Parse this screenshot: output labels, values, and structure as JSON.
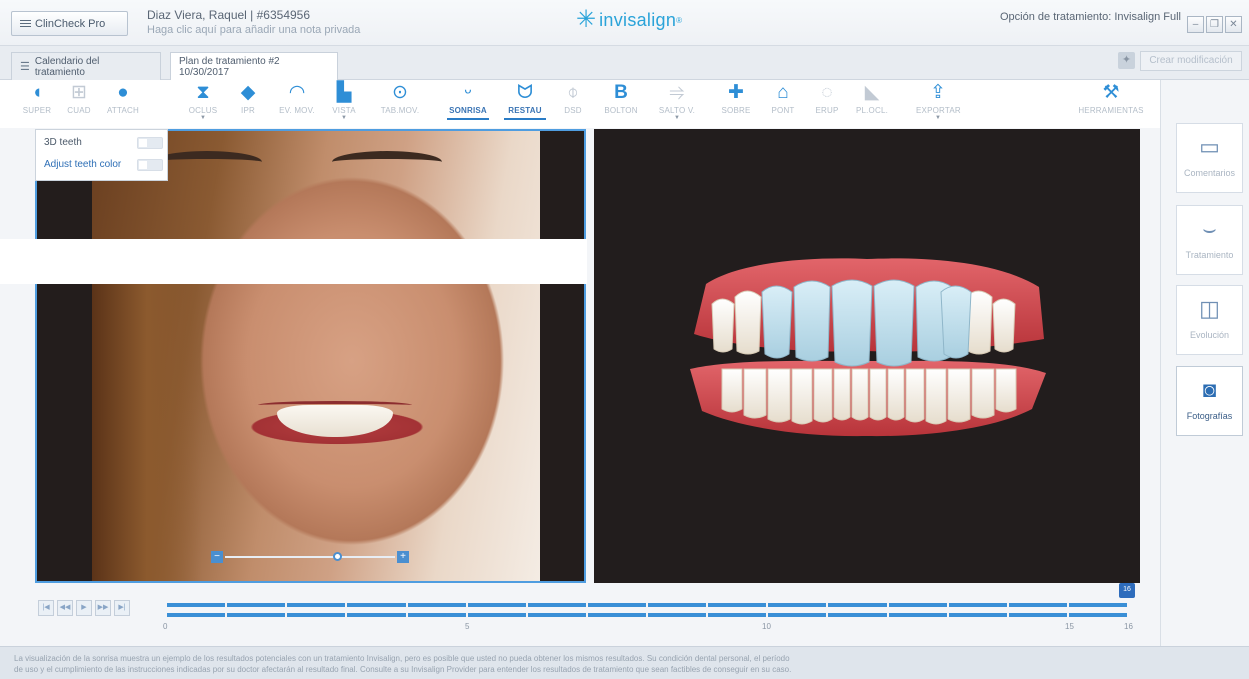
{
  "header": {
    "app_button": "ClinCheck Pro",
    "patient_name": "Diaz Viera, Raquel | #6354956",
    "private_note": "Haga clic aquí para añadir una nota privada",
    "logo_text": "invisalign",
    "treatment_option": "Opción de tratamiento: Invisalign Full"
  },
  "tabs": [
    {
      "label": "Calendario del tratamiento"
    },
    {
      "label": "Plan de tratamiento #2 10/30/2017"
    }
  ],
  "actions": {
    "create_modification": "Crear modificación"
  },
  "toolbar": {
    "tools": [
      {
        "label": "SUPER",
        "icon": "tooth-upper-icon"
      },
      {
        "label": "CUAD",
        "icon": "grid-icon"
      },
      {
        "label": "ATTACH",
        "icon": "attachment-icon"
      },
      {
        "label": "OCLUS",
        "icon": "occlusion-icon"
      },
      {
        "label": "IPR",
        "icon": "ipr-icon"
      },
      {
        "label": "EV. MOV.",
        "icon": "gauge-icon"
      },
      {
        "label": "VISTA",
        "icon": "view-icon"
      },
      {
        "label": "TAB.MOV.",
        "icon": "movement-table-icon"
      },
      {
        "label": "SONRISA",
        "icon": "smile-icon"
      },
      {
        "label": "RESTAU",
        "icon": "tooth-restore-icon"
      },
      {
        "label": "DSD",
        "icon": "dsd-icon"
      },
      {
        "label": "BOLTON",
        "icon": "bolton-icon"
      },
      {
        "label": "SALTO V.",
        "icon": "jump-icon"
      },
      {
        "label": "SOBRE",
        "icon": "overlay-icon"
      },
      {
        "label": "PONT",
        "icon": "pontic-icon"
      },
      {
        "label": "ERUP",
        "icon": "eruption-icon"
      },
      {
        "label": "PL.OCL.",
        "icon": "occlusal-plane-icon"
      },
      {
        "label": "EXPORTAR",
        "icon": "export-icon"
      },
      {
        "label": "HERRAMIENTAS",
        "icon": "tools-icon"
      }
    ]
  },
  "smile_popup": {
    "option1": "3D teeth",
    "option2": "Adjust teeth color"
  },
  "side_panel": {
    "buttons": [
      {
        "label": "Comentarios",
        "icon": "comment-icon"
      },
      {
        "label": "Tratamiento",
        "icon": "arch-icon"
      },
      {
        "label": "Evolución",
        "icon": "compare-icon"
      },
      {
        "label": "Fotografías",
        "icon": "camera-icon"
      }
    ]
  },
  "timeline": {
    "ticks": [
      "0",
      "5",
      "10",
      "15",
      "16"
    ],
    "current_stage": "16",
    "stage_count": 16,
    "colors": {
      "segment": "#3a8fd6",
      "marker": "#2e6cbc"
    }
  },
  "disclaimer": {
    "line1": "La visualización de la sonrisa muestra un ejemplo de los resultados potenciales con un tratamiento Invisalign, pero es posible que usted no pueda obtener los mismos resultados. Su condición dental personal, el período",
    "line2": "de uso y el cumplimiento de las instrucciones indicadas por su doctor afectarán al resultado final. Consulte a su Invisalign Provider para entender los resultados de tratamiento que sean factibles de conseguir en su caso."
  }
}
